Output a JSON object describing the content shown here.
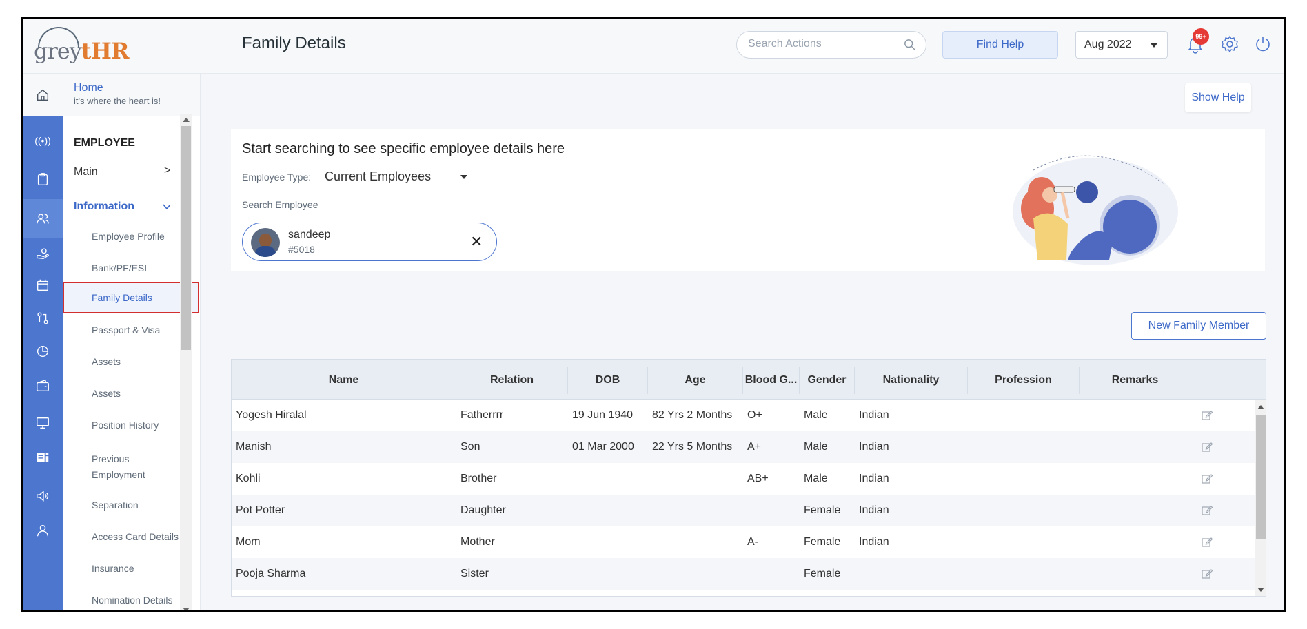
{
  "app": {
    "logo_prefix": "grey",
    "logo_suffix": "tHR",
    "logo_mid": "",
    "page_title": "Family Details"
  },
  "header": {
    "search_placeholder": "Search Actions",
    "find_help": "Find Help",
    "month": "Aug 2022",
    "notification_badge": "99+"
  },
  "sidebar": {
    "home_title": "Home",
    "home_subtitle": "it's where the heart is!",
    "section": "EMPLOYEE",
    "main": "Main",
    "information": "Information",
    "items": [
      "Employee Profile",
      "Bank/PF/ESI",
      "Family Details",
      "Passport & Visa",
      "Assets",
      "Assets",
      "Position History",
      "Previous Employment",
      "Separation",
      "Access Card Details",
      "Insurance",
      "Nomination Details"
    ]
  },
  "main": {
    "show_help": "Show Help",
    "search_heading": "Start searching to see specific employee details here",
    "employee_type_label": "Employee Type:",
    "employee_type_value": "Current Employees",
    "search_employee_label": "Search Employee",
    "selected_employee": {
      "name": "sandeep",
      "id": "#5018"
    },
    "new_member_button": "New Family Member"
  },
  "table": {
    "columns": [
      "Name",
      "Relation",
      "DOB",
      "Age",
      "Blood G...",
      "Gender",
      "Nationality",
      "Profession",
      "Remarks"
    ],
    "rows": [
      [
        "Yogesh Hiralal",
        "Fatherrrr",
        "19 Jun 1940",
        "82 Yrs 2 Months",
        "O+",
        "Male",
        "Indian",
        "",
        ""
      ],
      [
        "Manish",
        "Son",
        "01 Mar 2000",
        "22 Yrs 5 Months",
        "A+",
        "Male",
        "Indian",
        "",
        ""
      ],
      [
        "Kohli",
        "Brother",
        "",
        "",
        "AB+",
        "Male",
        "Indian",
        "",
        ""
      ],
      [
        "Pot Potter",
        "Daughter",
        "",
        "",
        "",
        "Female",
        "Indian",
        "",
        ""
      ],
      [
        "Mom",
        "Mother",
        "",
        "",
        "A-",
        "Female",
        "Indian",
        "",
        ""
      ],
      [
        "Pooja Sharma",
        "Sister",
        "",
        "",
        "",
        "Female",
        "",
        "",
        ""
      ]
    ]
  },
  "colors": {
    "accent": "#4d76cf",
    "brand_orange": "#e07b30",
    "highlight_border": "#d32f2f"
  }
}
